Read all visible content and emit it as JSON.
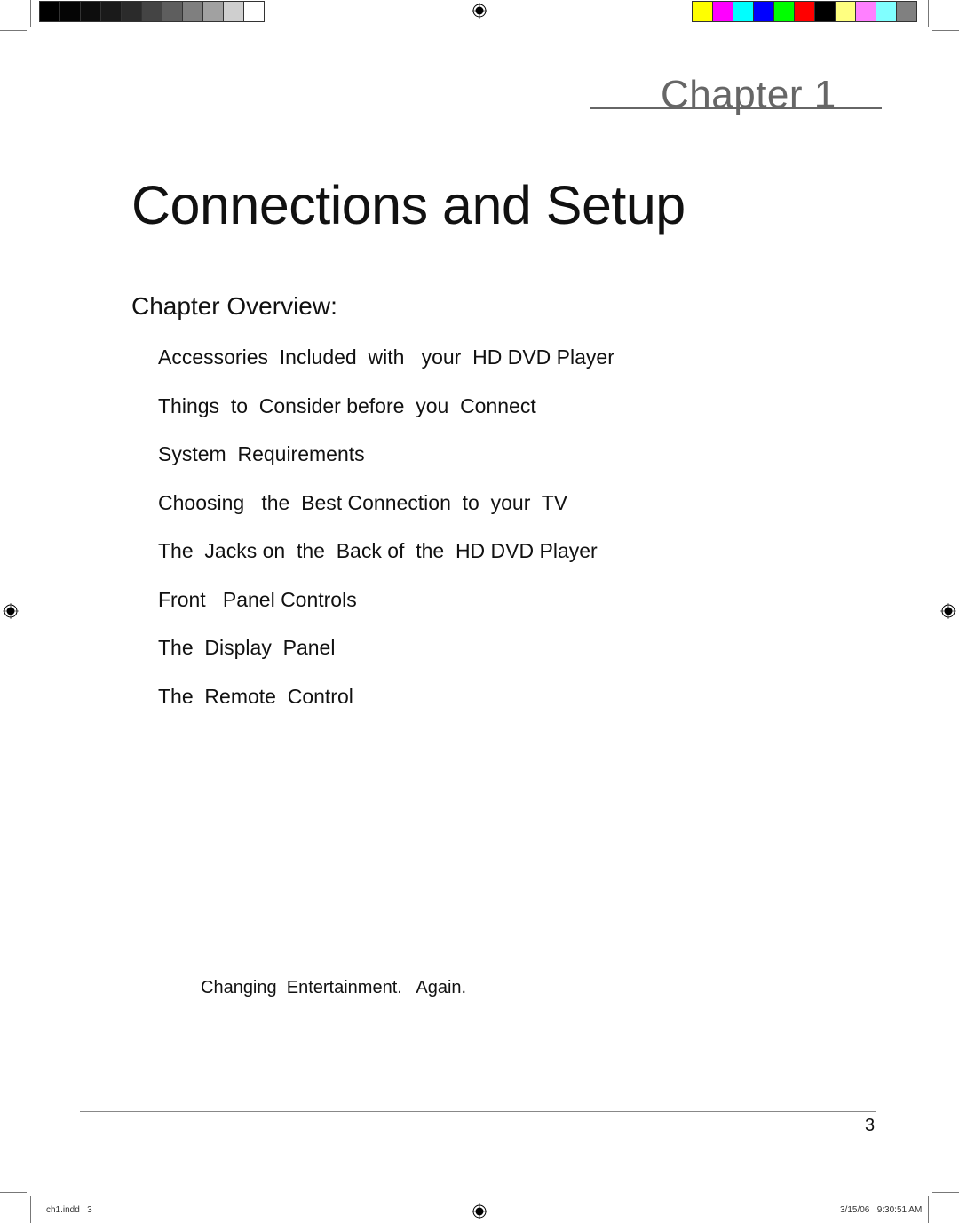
{
  "print_marks": {
    "gray_swatches": [
      "#000000",
      "#050505",
      "#0d0d0d",
      "#1a1a1a",
      "#2b2b2b",
      "#444444",
      "#5e5e5e",
      "#7f7f7f",
      "#a1a1a1",
      "#cfcfcf",
      "#ffffff"
    ],
    "color_swatches": [
      "#ffff00",
      "#ff00ff",
      "#00ffff",
      "#0000ff",
      "#00ff00",
      "#ff0000",
      "#000000",
      "#ffff80",
      "#ff80ff",
      "#80ffff",
      "#808080"
    ],
    "registration_icon": "crosshair-target-icon"
  },
  "header": {
    "chapter_label": "Chapter 1"
  },
  "page": {
    "title": "Connections and Setup",
    "overview_heading": "Chapter Overview:",
    "overview_items": [
      "Accessories  Included  with   your  HD DVD Player",
      "Things  to  Consider before  you  Connect",
      "System  Requirements",
      "Choosing   the  Best Connection  to  your  TV",
      "The  Jacks on  the  Back of  the  HD DVD Player",
      "Front   Panel Controls",
      "The  Display  Panel",
      "The  Remote  Control"
    ],
    "tagline": "Changing  Entertainment.   Again."
  },
  "footer": {
    "page_number": "3",
    "slug_file": "ch1.indd   3",
    "slug_timestamp": "3/15/06   9:30:51 AM"
  }
}
